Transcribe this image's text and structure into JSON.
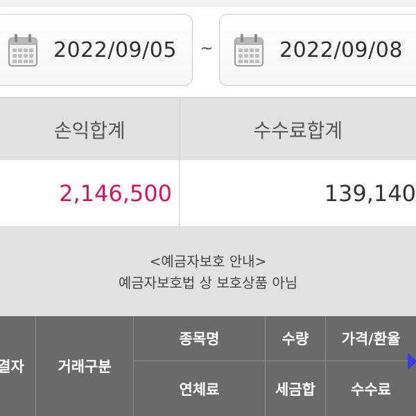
{
  "date_range": {
    "start": "2022/09/05",
    "separator": "~",
    "end": "2022/09/08",
    "icon": "calendar-icon"
  },
  "summary": {
    "profit_label": "손익합계",
    "fee_label": "수수료합계",
    "profit_value": "2,146,500",
    "fee_value": "139,140",
    "profit_color": "#d2145f"
  },
  "notice": {
    "title": "<예금자보호 안내>",
    "body": "예금자보호법 상 보호상품 아님"
  },
  "table": {
    "header_bg": "#6a6a6a",
    "col0": "결자",
    "col1": "거래구분",
    "col2_top": "종목명",
    "col2_bottom": "연체료",
    "col3_top": "수량",
    "col3_bottom": "세금합",
    "col4_top": "가격/환율",
    "col4_bottom": "수수료",
    "scroll_icon": "arrow-right-icon"
  }
}
